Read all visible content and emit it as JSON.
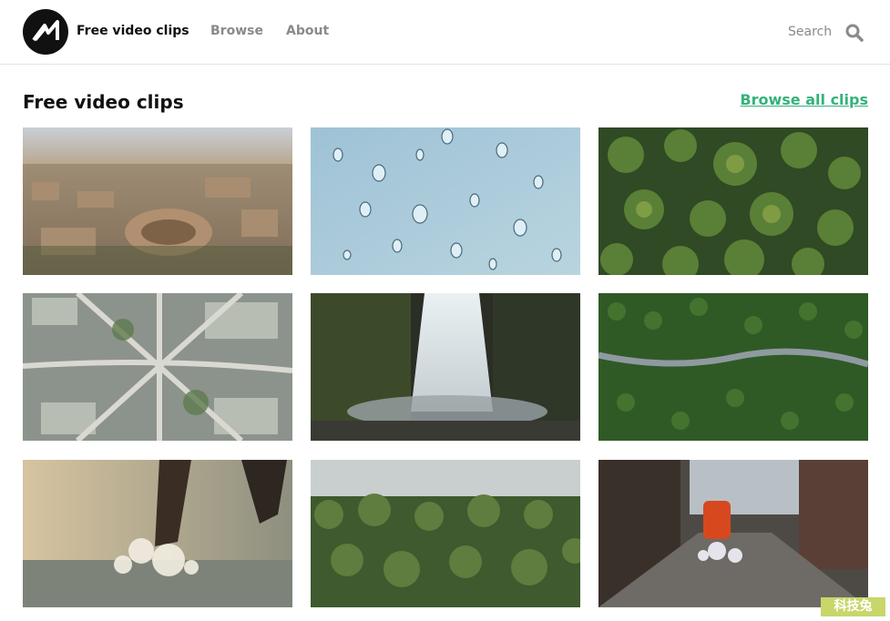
{
  "header": {
    "brand": "Free video clips",
    "nav": [
      {
        "label": "Browse"
      },
      {
        "label": "About"
      }
    ],
    "search_label": "Search"
  },
  "section": {
    "title": "Free video clips",
    "browse_all": "Browse all clips"
  },
  "clips": [
    {
      "subject": "aerial city with colosseum"
    },
    {
      "subject": "water drops on glass"
    },
    {
      "subject": "aerial pine forest"
    },
    {
      "subject": "aerial highway interchange"
    },
    {
      "subject": "waterfall"
    },
    {
      "subject": "road through forest aerial"
    },
    {
      "subject": "splash in sunset water"
    },
    {
      "subject": "misty forest landscape"
    },
    {
      "subject": "street with trash and scooter"
    }
  ],
  "watermark": "科技兔",
  "colors": {
    "accent": "#34b27b",
    "muted": "#8a8a8a",
    "text": "#111111"
  }
}
